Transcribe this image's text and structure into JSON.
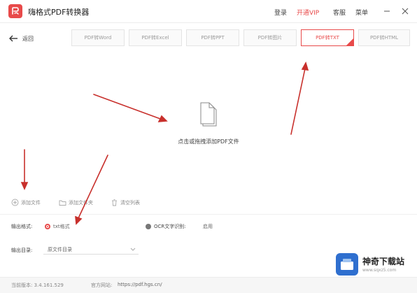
{
  "app": {
    "title": "嗨格式PDF转换器",
    "accent_color": "#e84a4a"
  },
  "menu": {
    "login": "登录",
    "vip": "开通VIP",
    "service": "客服",
    "more": "菜单"
  },
  "window_controls": [
    "minimize-icon",
    "close-icon"
  ],
  "nav": {
    "back_label": "返回",
    "back_icon": "arrow-left-icon"
  },
  "tabs": [
    {
      "label": "PDF转Word",
      "active": false
    },
    {
      "label": "PDF转Excel",
      "active": false
    },
    {
      "label": "PDF转PPT",
      "active": false
    },
    {
      "label": "PDF转图片",
      "active": false
    },
    {
      "label": "PDF转TXT",
      "active": true
    },
    {
      "label": "PDF转HTML",
      "active": false
    }
  ],
  "drop_zone": {
    "icon": "document-icon",
    "text": "点击或拖拽添加PDF文件"
  },
  "actions": {
    "add_file": "添加文件",
    "add_folder": "添加文件夹",
    "clear_list": "清空列表"
  },
  "options": {
    "format_label": "输出格式:",
    "format_value": "txt格式",
    "ocr_label": "OCR文字识别:",
    "ocr_value": "启用",
    "dir_label": "输出目录:",
    "dir_value": "原文件目录"
  },
  "status": {
    "version": "当前版本: 3.4.161.529",
    "website_label": "官方网站:",
    "website_url": "https://pdf.hgs.cn/"
  },
  "watermark": {
    "name": "神奇下载站",
    "url": "www.sqxz5.com"
  }
}
